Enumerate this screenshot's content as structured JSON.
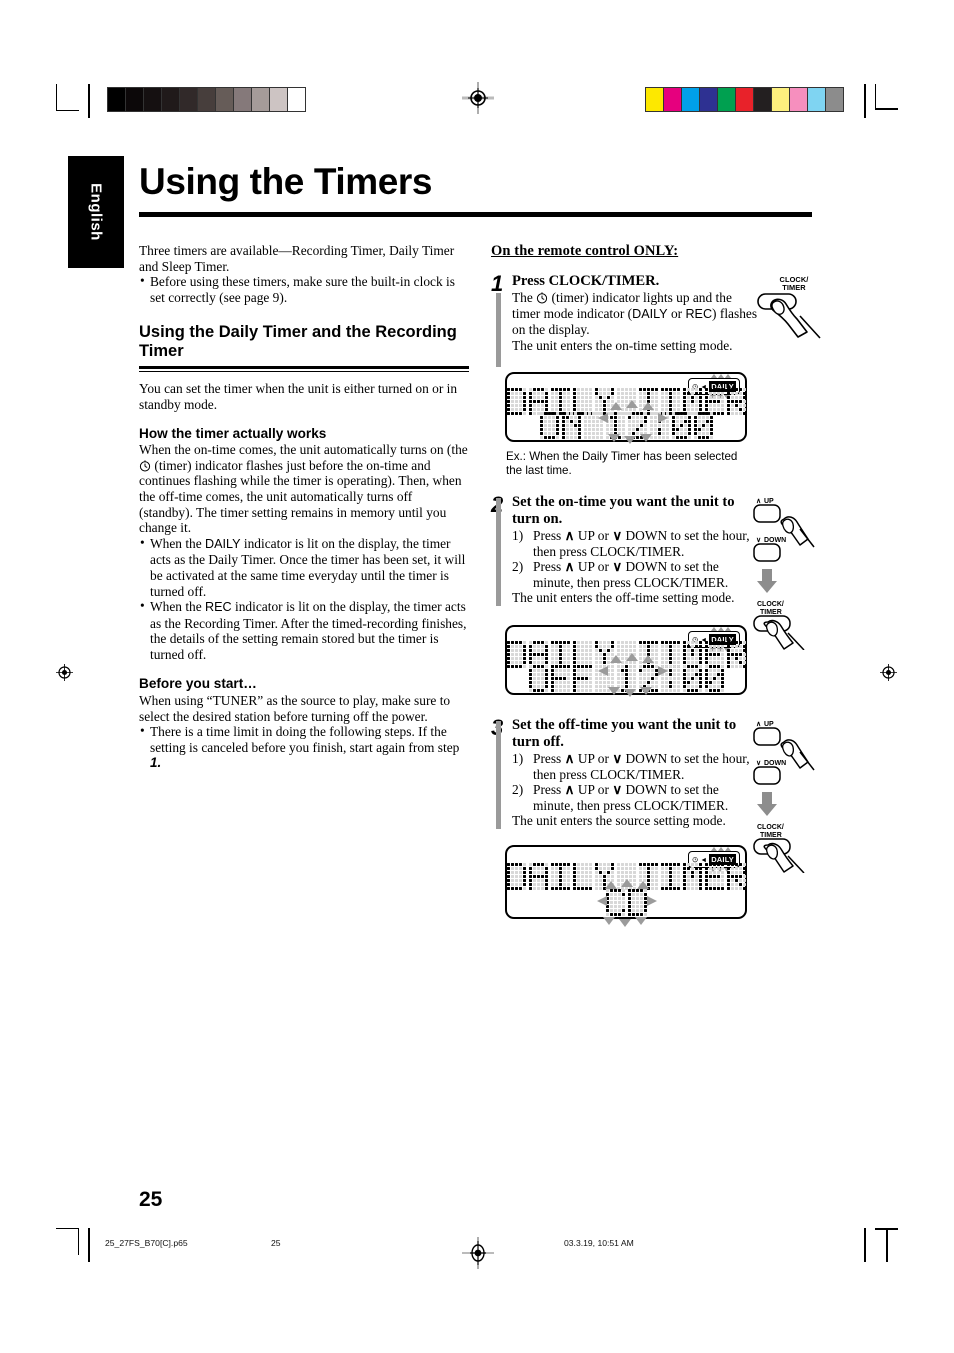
{
  "page": {
    "language_tab": "English",
    "title": "Using the Timers",
    "page_number": "25"
  },
  "left_column": {
    "intro": "Three timers are available—Recording Timer, Daily Timer and Sleep Timer.",
    "intro_bullets": [
      "Before using these timers, make sure the built-in clock is set correctly (see page 9)."
    ],
    "section_heading": "Using the Daily Timer and the Recording Timer",
    "section_intro": "You can set the timer when the unit is either turned on or in standby mode.",
    "how_heading": "How the timer actually works",
    "how_body_1": "When the on-time comes, the unit automatically turns on (the",
    "how_body_2": "(timer) indicator flashes just before the on-time and continues flashing while the timer is operating). Then, when the off-time comes, the unit automatically turns off (standby). The timer setting remains in memory until you change it.",
    "how_bullets": [
      {
        "pre": "When the",
        "ind": "DAILY",
        "post": "indicator is lit on the display, the timer acts as the Daily Timer. Once the timer has been set, it will be activated at the same time everyday until the timer is turned off."
      },
      {
        "pre": "When the",
        "ind": "REC",
        "post": "indicator is lit on the display, the timer acts as the Recording Timer. After the timed-recording finishes, the details of the setting remain stored but the timer is turned off."
      }
    ],
    "before_heading": "Before you start…",
    "before_body": "When using “TUNER” as the source to play, make sure to select the desired station before turning off the power.",
    "before_bullets_pre": "There is a time limit in doing the following steps. If the setting is canceled before you finish, start again from step",
    "before_bullets_step": "1."
  },
  "right_column": {
    "heading": "On the remote control ONLY:",
    "steps": [
      {
        "number": "1",
        "title": "Press CLOCK/TIMER.",
        "body_pre": "The",
        "body_post": "(timer) indicator lights up and the timer mode indicator (",
        "ind_a": "DAILY",
        "ind_or": "or",
        "ind_b": "REC",
        "body_tail": ") flashes on the display.",
        "body_last": "The unit enters the on-time setting mode."
      },
      {
        "number": "2",
        "title": "Set the on-time you want the unit to turn on.",
        "sub": [
          {
            "n": "1)",
            "text_pre": "Press",
            "up": "UP",
            "or": "or",
            "down": "DOWN",
            "text_post": "to set the hour, then press CLOCK/TIMER."
          },
          {
            "n": "2)",
            "text_pre": "Press",
            "up": "UP",
            "or": "or",
            "down": "DOWN",
            "text_post": "to set the minute, then press CLOCK/TIMER."
          }
        ],
        "tail": "The unit enters the off-time setting mode."
      },
      {
        "number": "3",
        "title": "Set the off-time you want the unit to turn off.",
        "sub": [
          {
            "n": "1)",
            "text_pre": "Press",
            "up": "UP",
            "or": "or",
            "down": "DOWN",
            "text_post": "to set the hour, then press CLOCK/TIMER."
          },
          {
            "n": "2)",
            "text_pre": "Press",
            "up": "UP",
            "or": "or",
            "down": "DOWN",
            "text_post": "to set the minute, then press CLOCK/TIMER."
          }
        ],
        "tail": "The unit enters the source setting mode."
      }
    ],
    "displays": [
      {
        "line1": "DAILY TIMER",
        "line2": "ON 12:00",
        "badge": "DAILY",
        "flash_target": "12"
      },
      {
        "line1": "DAILY TIMER",
        "line2": "OFF 12:00",
        "badge": "DAILY",
        "flash_target": "12"
      },
      {
        "line1": "DAILY TIMER",
        "line2": "CD",
        "badge": "DAILY",
        "flash_target": "CD"
      }
    ],
    "display_note": "Ex.: When the Daily Timer has been selected the last time.",
    "buttons": {
      "clock_timer": "CLOCK/\nTIMER",
      "clock_timer_l1": "CLOCK/",
      "clock_timer_l2": "TIMER",
      "up": "UP",
      "down": "DOWN"
    }
  },
  "footer": {
    "filename": "25_27FS_B70[C].p65",
    "page": "25",
    "timestamp": "03.3.19, 10:51 AM"
  },
  "print_marks": {
    "gray_wedge": [
      "#000000",
      "#0c0809",
      "#151011",
      "#201a1a",
      "#312929",
      "#473e3c",
      "#665c58",
      "#85797a",
      "#a59b99",
      "#cdc4c3",
      "#ffffff"
    ],
    "color_wedge": [
      "#fde800",
      "#e6007e",
      "#00a0e9",
      "#2e3192",
      "#00a050",
      "#e8222a",
      "#231f20",
      "#fdf07e",
      "#f68fbe",
      "#7fd4f2",
      "#8c8c8c"
    ]
  }
}
